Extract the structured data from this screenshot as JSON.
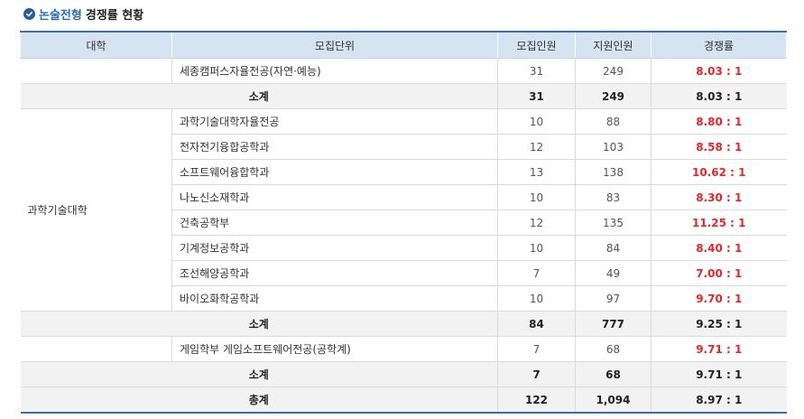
{
  "heading": {
    "accent": "논술전형",
    "rest": "경쟁률 현황"
  },
  "columns": [
    "대학",
    "모집단위",
    "모집인원",
    "지원인원",
    "경쟁률"
  ],
  "groups": [
    {
      "univ": "",
      "rows": [
        {
          "unit": "세종캠퍼스자율전공(자연·예능)",
          "quota": "31",
          "applicants": "249",
          "ratio": "8.03 : 1"
        }
      ],
      "subtotal": {
        "label": "소계",
        "quota": "31",
        "applicants": "249",
        "ratio": "8.03 : 1"
      }
    },
    {
      "univ": "과학기술대학",
      "rows": [
        {
          "unit": "과학기술대학자율전공",
          "quota": "10",
          "applicants": "88",
          "ratio": "8.80 : 1"
        },
        {
          "unit": "전자전기융합공학과",
          "quota": "12",
          "applicants": "103",
          "ratio": "8.58 : 1"
        },
        {
          "unit": "소프트웨어융합학과",
          "quota": "13",
          "applicants": "138",
          "ratio": "10.62 : 1"
        },
        {
          "unit": "나노신소재학과",
          "quota": "10",
          "applicants": "83",
          "ratio": "8.30 : 1"
        },
        {
          "unit": "건축공학부",
          "quota": "12",
          "applicants": "135",
          "ratio": "11.25 : 1"
        },
        {
          "unit": "기계정보공학과",
          "quota": "10",
          "applicants": "84",
          "ratio": "8.40 : 1"
        },
        {
          "unit": "조선해양공학과",
          "quota": "7",
          "applicants": "49",
          "ratio": "7.00 : 1"
        },
        {
          "unit": "바이오화학공학과",
          "quota": "10",
          "applicants": "97",
          "ratio": "9.70 : 1"
        }
      ],
      "subtotal": {
        "label": "소계",
        "quota": "84",
        "applicants": "777",
        "ratio": "9.25 : 1"
      }
    },
    {
      "univ": "",
      "rows": [
        {
          "unit": "게임학부 게임소프트웨어전공(공학계)",
          "quota": "7",
          "applicants": "68",
          "ratio": "9.71 : 1"
        }
      ],
      "subtotal": {
        "label": "소계",
        "quota": "7",
        "applicants": "68",
        "ratio": "9.71 : 1"
      }
    }
  ],
  "total": {
    "label": "총계",
    "quota": "122",
    "applicants": "1,094",
    "ratio": "8.97 : 1"
  },
  "colors": {
    "accent": "#2a6bb5",
    "header_bg": "#d5e3f3",
    "ratio_red": "#e8262a",
    "border_blue": "#3f6eb0"
  }
}
